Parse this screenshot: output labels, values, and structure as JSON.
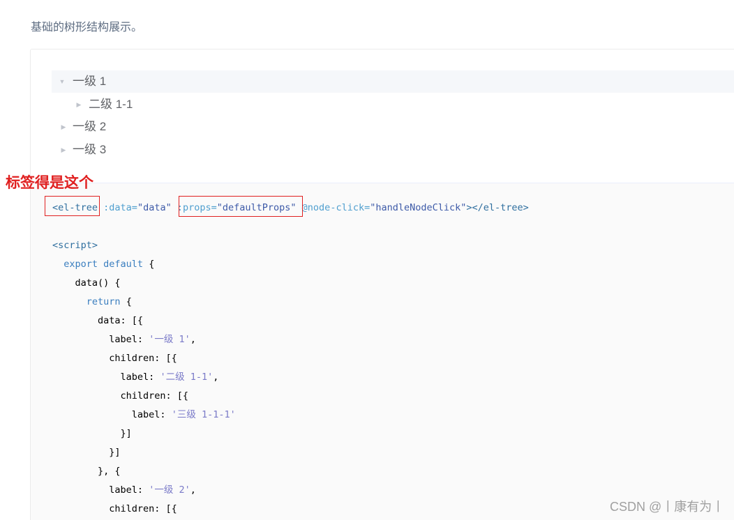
{
  "description": "基础的树形结构展示。",
  "tree": {
    "nodes": [
      {
        "label": "一级 1",
        "expanded": true
      },
      {
        "label": "二级 1-1",
        "expanded": false
      },
      {
        "label": "一级 2",
        "expanded": false
      },
      {
        "label": "一级 3",
        "expanded": false
      }
    ]
  },
  "annotation": "标签得是这个",
  "code": {
    "line1": {
      "t1": "<el-tree",
      "t2": " :data=",
      "t3": "\"data\"",
      "t4": " :props=",
      "t5": "\"defaultProps\"",
      "t6": " @node-click=",
      "t7": "\"handleNodeClick\"",
      "t8": "></el-tree>"
    },
    "script_open": "<script>",
    "export_kw": "export default",
    "export_brace": " {",
    "data_fn": "    data() {",
    "return_kw": "return",
    "return_brace": " {",
    "data_key": "        data: [{",
    "label_key": "label: ",
    "label_1": "'一级 1'",
    "comma": ",",
    "children_1": "          children: [{",
    "label_2": "'二级 1-1'",
    "children_2": "            children: [{",
    "label_3": "'三级 1-1-1'",
    "close_1": "            }]",
    "close_2": "          }]",
    "close_3": "        }, {",
    "label_4": "'一级 2'",
    "children_3": "          children: [{"
  },
  "watermark": "CSDN @丨康有为丨"
}
